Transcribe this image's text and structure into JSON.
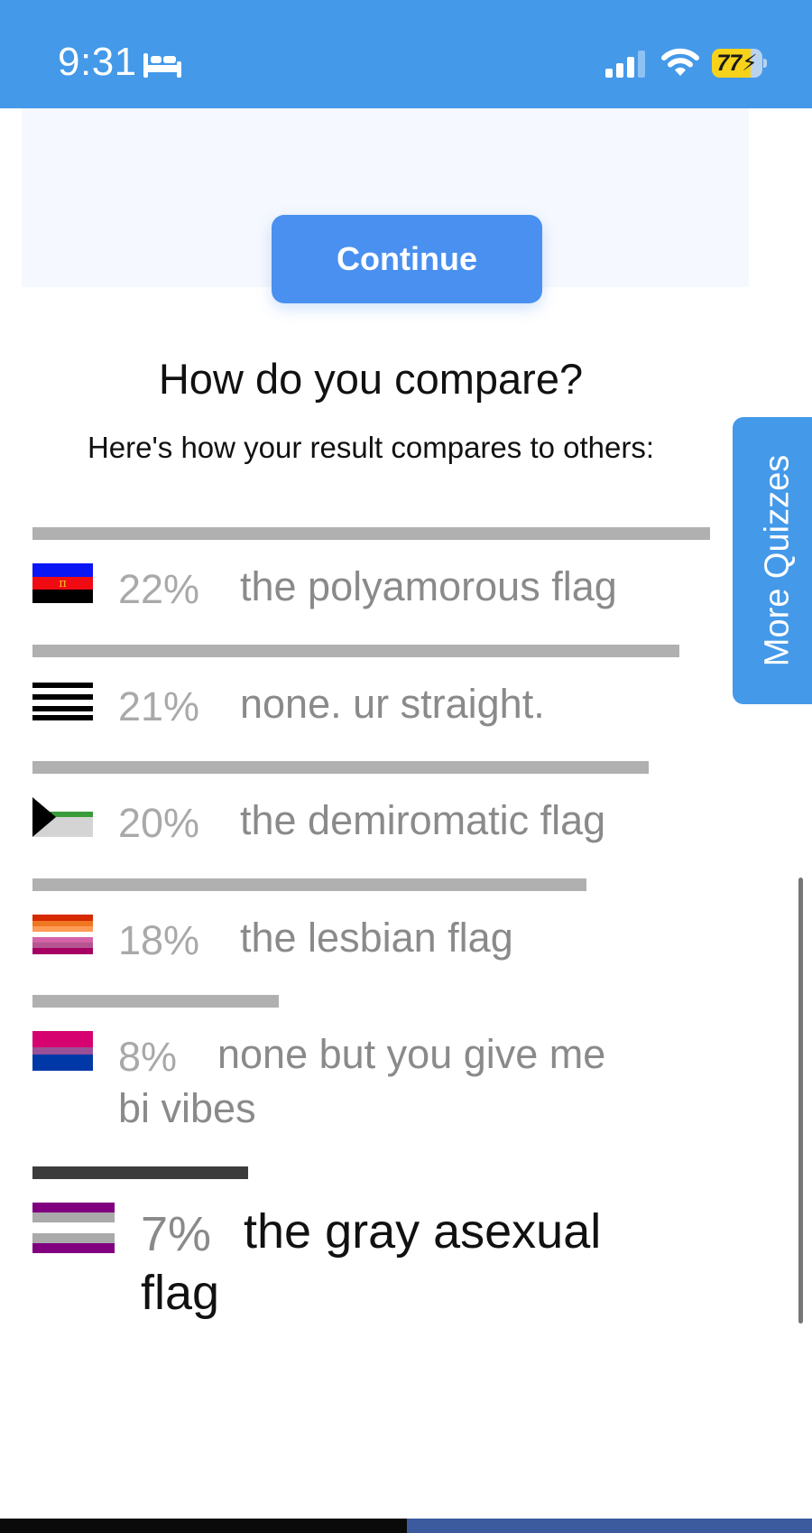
{
  "status_bar": {
    "time": "9:31",
    "battery_level": "77",
    "battery_percent": 77,
    "icons": [
      "bed-icon",
      "cellular-signal-icon",
      "wifi-icon",
      "battery-charging-icon"
    ]
  },
  "top_card": {
    "continue_label": "Continue"
  },
  "compare": {
    "title": "How do you compare?",
    "subtitle": "Here's how your result compares to others:"
  },
  "results": [
    {
      "percent_label": "22%",
      "percent": 22,
      "label": "the polyamorous flag",
      "flag": "polyamorous-flag-icon"
    },
    {
      "percent_label": "21%",
      "percent": 21,
      "label": "none. ur straight.",
      "flag": "straight-flag-icon"
    },
    {
      "percent_label": "20%",
      "percent": 20,
      "label": "the demiromatic flag",
      "flag": "demiromantic-flag-icon"
    },
    {
      "percent_label": "18%",
      "percent": 18,
      "label": "the lesbian flag",
      "flag": "lesbian-flag-icon"
    },
    {
      "percent_label": "8%",
      "percent": 8,
      "label": "none but you give me bi vibes",
      "flag": "bisexual-flag-icon"
    },
    {
      "percent_label": "7%",
      "percent": 7,
      "label": "the gray asexual flag",
      "flag": "gray-asexual-flag-icon",
      "is_user_result": true
    }
  ],
  "side_tab": {
    "label": "More Quizzes"
  },
  "colors": {
    "status_bar": "#4499e9",
    "button": "#4a90f0",
    "bar": "#b0b0b0",
    "highlight_bar": "#3c3c3c"
  }
}
